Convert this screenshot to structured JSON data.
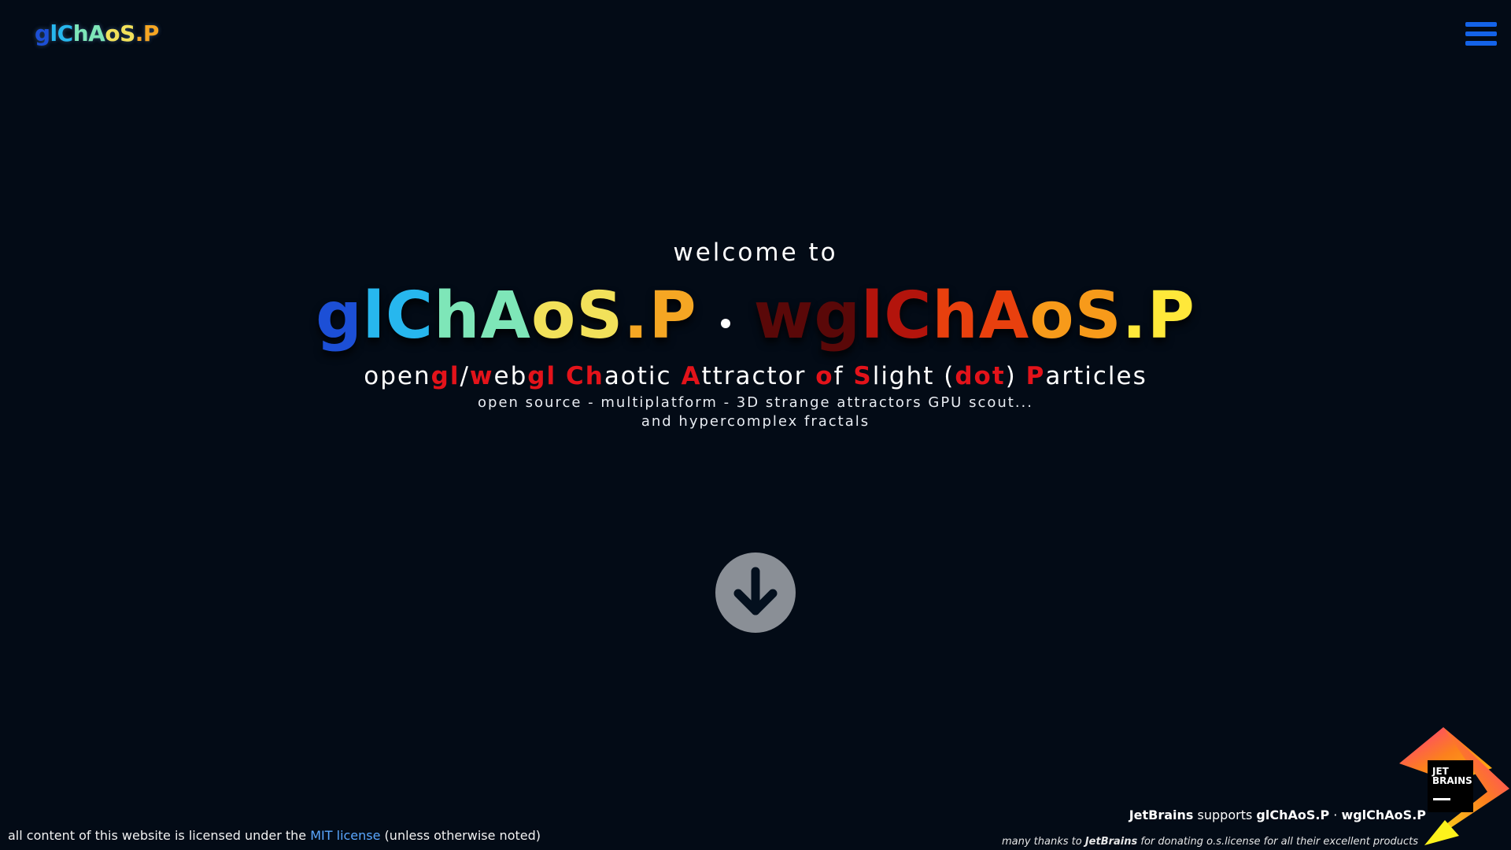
{
  "header": {
    "logo_text": "glChAoS.P",
    "menu_icon": "hamburger-menu-icon"
  },
  "hero": {
    "welcome": "welcome to",
    "title_left": "glChAoS.P",
    "title_right": "wglChAoS.P",
    "title_separator": "·",
    "acronym_parts": [
      {
        "t": "open",
        "hl": false
      },
      {
        "t": "gl",
        "hl": true
      },
      {
        "t": "/",
        "hl": false
      },
      {
        "t": "w",
        "hl": true
      },
      {
        "t": "eb",
        "hl": false
      },
      {
        "t": "gl",
        "hl": true
      },
      {
        "t": " ",
        "hl": false
      },
      {
        "t": "Ch",
        "hl": true
      },
      {
        "t": "aotic ",
        "hl": false
      },
      {
        "t": "A",
        "hl": true
      },
      {
        "t": "ttractor ",
        "hl": false
      },
      {
        "t": "o",
        "hl": true
      },
      {
        "t": "f ",
        "hl": false
      },
      {
        "t": "S",
        "hl": true
      },
      {
        "t": "light (",
        "hl": false
      },
      {
        "t": "dot",
        "hl": true
      },
      {
        "t": ") ",
        "hl": false
      },
      {
        "t": "P",
        "hl": true
      },
      {
        "t": "articles",
        "hl": false
      }
    ],
    "subline_1": "open source - multiplatform - 3D strange attractors GPU scout...",
    "subline_2": "and hypercomplex fractals",
    "scroll_icon": "arrow-down-circle-icon"
  },
  "footer": {
    "license_prefix": "all content of this website is licensed under the ",
    "license_link": "MIT license",
    "license_suffix": " (unless otherwise noted)",
    "jb_brand": "JetBrains",
    "jb_supports": " supports ",
    "jb_product_1": "glChAoS.P",
    "jb_dot": " · ",
    "jb_product_2": "wglChAoS.P",
    "thanks_prefix": "many thanks to ",
    "thanks_brand": "JetBrains",
    "thanks_suffix": " for donating o.s.license for all their excellent products",
    "jb_logo_line1": "JET",
    "jb_logo_line2": "BRAINS"
  },
  "colors": {
    "background": "#030b16",
    "menu_accent": "#1463e8",
    "acronym_highlight": "#e3131a",
    "link": "#5aa7ff",
    "left_gradient": [
      "#1c4fd6",
      "#27b7ee",
      "#7ee6b8",
      "#f2e15a",
      "#f5a623"
    ],
    "right_gradient": [
      "#5a0808",
      "#b3140c",
      "#e8400e",
      "#f79a1a",
      "#ffe83a"
    ]
  }
}
